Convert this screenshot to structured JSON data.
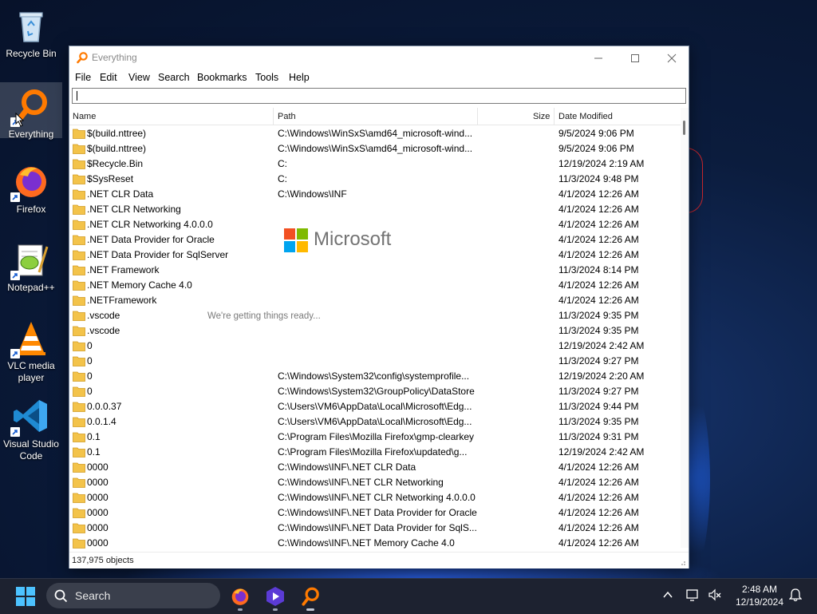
{
  "desktop": {
    "icons": [
      {
        "label": "Recycle Bin"
      },
      {
        "label": "Everything"
      },
      {
        "label": "Firefox"
      },
      {
        "label": "Notepad++"
      },
      {
        "label": "VLC media player"
      },
      {
        "label": "Visual Studio Code"
      }
    ]
  },
  "window": {
    "title": "Everything",
    "menu": [
      "File",
      "Edit",
      "View",
      "Search",
      "Bookmarks",
      "Tools",
      "Help"
    ],
    "search_value": "",
    "columns": {
      "name": "Name",
      "path": "Path",
      "size": "Size",
      "date": "Date Modified"
    },
    "rows": [
      {
        "name": "$(build.nttree)",
        "path": "C:\\Windows\\WinSxS\\amd64_microsoft-wind...",
        "date": "9/5/2024 9:06 PM"
      },
      {
        "name": "$(build.nttree)",
        "path": "C:\\Windows\\WinSxS\\amd64_microsoft-wind...",
        "date": "9/5/2024 9:06 PM"
      },
      {
        "name": "$Recycle.Bin",
        "path": "C:",
        "date": "12/19/2024 2:19 AM"
      },
      {
        "name": "$SysReset",
        "path": "C:",
        "date": "11/3/2024 9:48 PM"
      },
      {
        "name": ".NET CLR Data",
        "path": "C:\\Windows\\INF",
        "date": "4/1/2024 12:26 AM"
      },
      {
        "name": ".NET CLR Networking",
        "path": "",
        "date": "4/1/2024 12:26 AM"
      },
      {
        "name": ".NET CLR Networking 4.0.0.0",
        "path": "",
        "date": "4/1/2024 12:26 AM"
      },
      {
        "name": ".NET Data Provider for Oracle",
        "path": "",
        "date": "4/1/2024 12:26 AM"
      },
      {
        "name": ".NET Data Provider for SqlServer",
        "path": "",
        "date": "4/1/2024 12:26 AM"
      },
      {
        "name": ".NET Framework",
        "path": "",
        "date": "11/3/2024 8:14 PM"
      },
      {
        "name": ".NET Memory Cache 4.0",
        "path": "",
        "date": "4/1/2024 12:26 AM"
      },
      {
        "name": ".NETFramework",
        "path": "",
        "date": "4/1/2024 12:26 AM"
      },
      {
        "name": ".vscode",
        "path": "",
        "date": "11/3/2024 9:35 PM"
      },
      {
        "name": ".vscode",
        "path": "",
        "date": "11/3/2024 9:35 PM"
      },
      {
        "name": "0",
        "path": "",
        "date": "12/19/2024 2:42 AM"
      },
      {
        "name": "0",
        "path": "",
        "date": "11/3/2024 9:27 PM"
      },
      {
        "name": "0",
        "path": "C:\\Windows\\System32\\config\\systemprofile...",
        "date": "12/19/2024 2:20 AM"
      },
      {
        "name": "0",
        "path": "C:\\Windows\\System32\\GroupPolicy\\DataStore",
        "date": "11/3/2024 9:27 PM"
      },
      {
        "name": "0.0.0.37",
        "path": "C:\\Users\\VM6\\AppData\\Local\\Microsoft\\Edg...",
        "date": "11/3/2024 9:44 PM"
      },
      {
        "name": "0.0.1.4",
        "path": "C:\\Users\\VM6\\AppData\\Local\\Microsoft\\Edg...",
        "date": "11/3/2024 9:35 PM"
      },
      {
        "name": "0.1",
        "path": "C:\\Program Files\\Mozilla Firefox\\gmp-clearkey",
        "date": "11/3/2024 9:31 PM"
      },
      {
        "name": "0.1",
        "path": "C:\\Program Files\\Mozilla Firefox\\updated\\g...",
        "date": "12/19/2024 2:42 AM"
      },
      {
        "name": "0000",
        "path": "C:\\Windows\\INF\\.NET CLR Data",
        "date": "4/1/2024 12:26 AM"
      },
      {
        "name": "0000",
        "path": "C:\\Windows\\INF\\.NET CLR Networking",
        "date": "4/1/2024 12:26 AM"
      },
      {
        "name": "0000",
        "path": "C:\\Windows\\INF\\.NET CLR Networking 4.0.0.0",
        "date": "4/1/2024 12:26 AM"
      },
      {
        "name": "0000",
        "path": "C:\\Windows\\INF\\.NET Data Provider for Oracle",
        "date": "4/1/2024 12:26 AM"
      },
      {
        "name": "0000",
        "path": "C:\\Windows\\INF\\.NET Data Provider for SqlS...",
        "date": "4/1/2024 12:26 AM"
      },
      {
        "name": "0000",
        "path": "C:\\Windows\\INF\\.NET Memory Cache 4.0",
        "date": "4/1/2024 12:26 AM"
      }
    ],
    "status": "137,975 objects"
  },
  "splash": {
    "brand": "Microsoft",
    "message": "We're getting things ready..."
  },
  "taskbar": {
    "search_label": "Search",
    "apps": [
      "firefox-icon",
      "clipchamp-icon",
      "everything-icon"
    ],
    "time": "2:48 AM",
    "date": "12/19/2024"
  },
  "colors": {
    "folder": "#f3c34a",
    "accent": "#ff7a00",
    "ms_red": "#f25022",
    "ms_green": "#7fba00",
    "ms_blue": "#00a4ef",
    "ms_yellow": "#ffb900"
  }
}
